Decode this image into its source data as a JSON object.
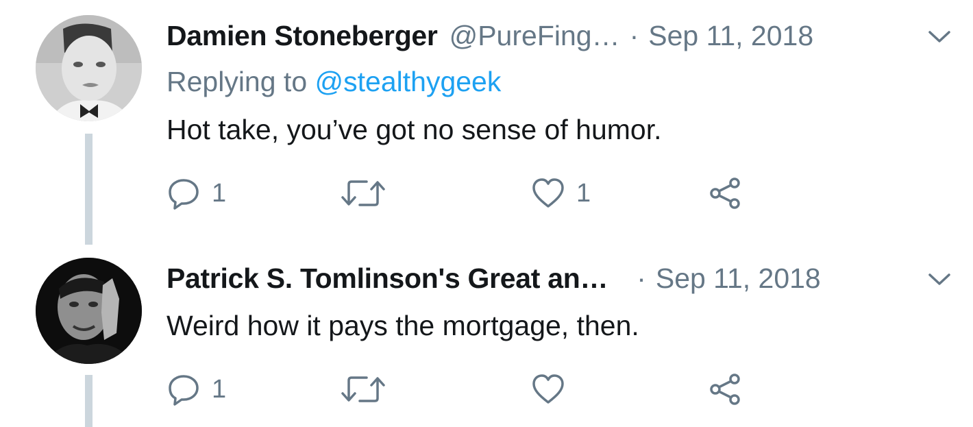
{
  "tweets": [
    {
      "author_name": "Damien Stoneberger",
      "handle": "@PureFing…",
      "separator": "·",
      "date": "Sep 11, 2018",
      "replying_prefix": "Replying to",
      "replying_mention": "@stealthygeek",
      "text": "Hot take, you’ve got no sense of humor.",
      "reply_count": "1",
      "retweet_count": "",
      "like_count": "1",
      "icons": {
        "reply": "reply-icon",
        "retweet": "retweet-icon",
        "like": "heart-icon",
        "share": "share-icon",
        "menu": "chevron-down-icon"
      }
    },
    {
      "author_name": "Patrick S. Tomlinson's Great an…",
      "separator": "·",
      "date": "Sep 11, 2018",
      "text": "Weird how it pays the mortgage, then.",
      "reply_count": "1",
      "retweet_count": "",
      "like_count": "",
      "icons": {
        "reply": "reply-icon",
        "retweet": "retweet-icon",
        "like": "heart-icon",
        "share": "share-icon",
        "menu": "chevron-down-icon"
      }
    }
  ],
  "colors": {
    "text_primary": "#14171a",
    "text_secondary": "#657786",
    "link": "#1da1f2",
    "thread_line": "#ccd6dd"
  }
}
